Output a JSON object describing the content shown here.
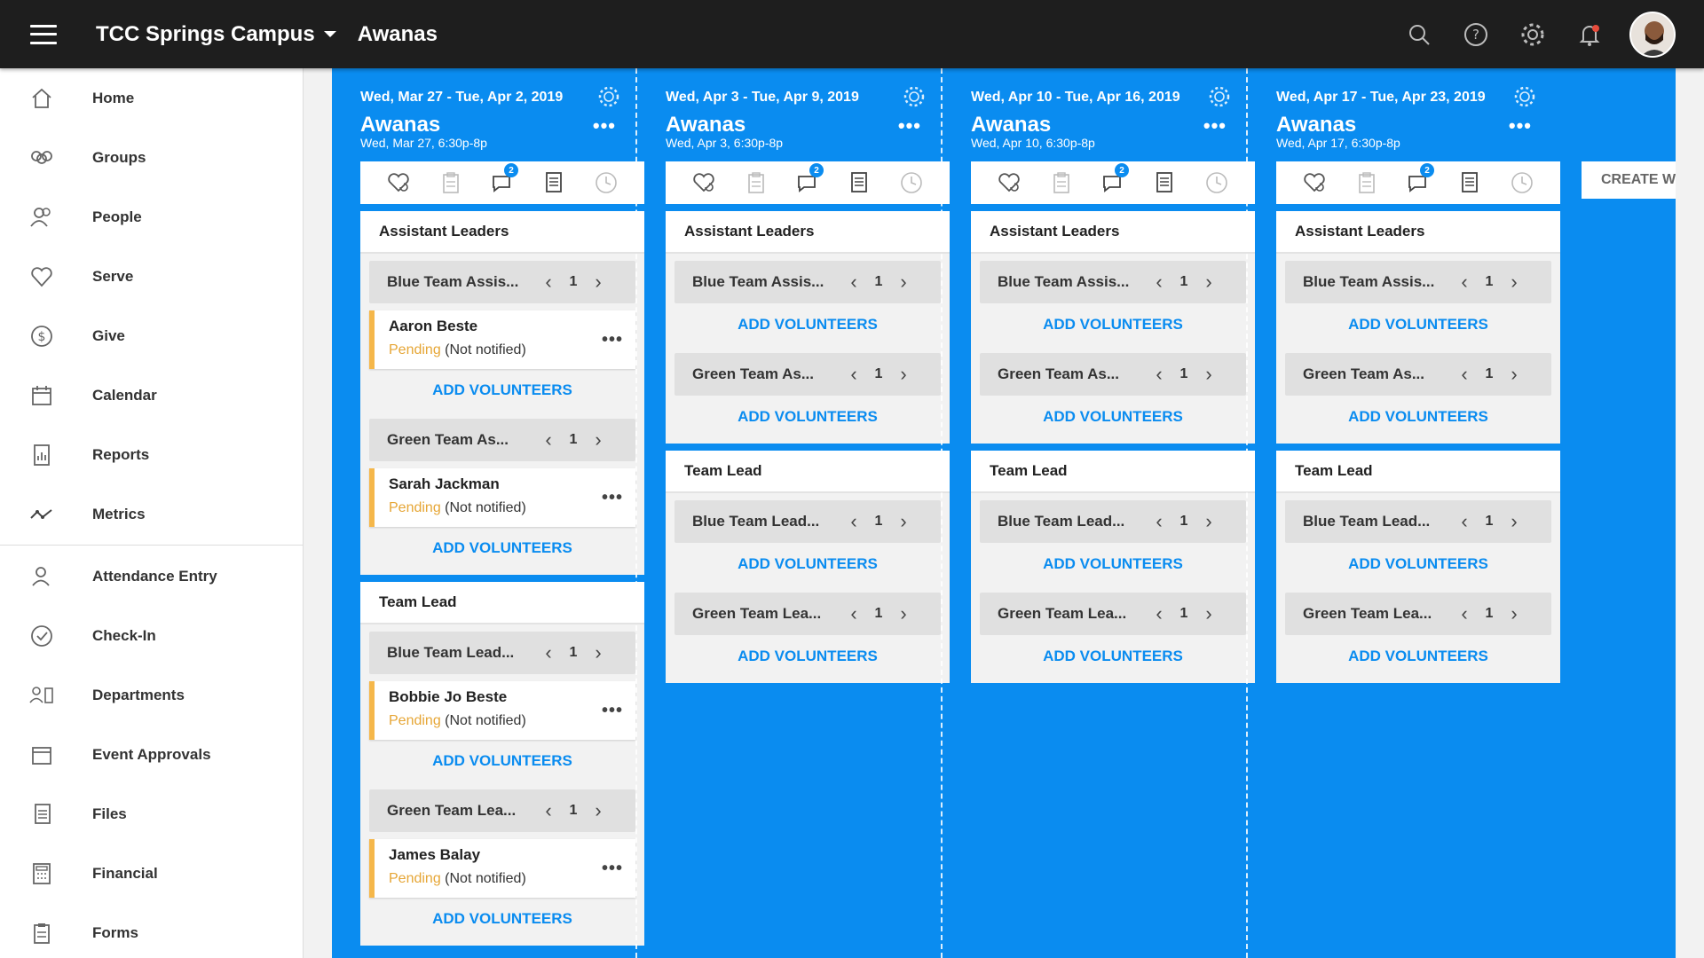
{
  "header": {
    "campus": "TCC Springs Campus",
    "page_title": "Awanas",
    "icons": [
      "search-icon",
      "help-icon",
      "gear-icon",
      "notification-bell-icon"
    ]
  },
  "sidebar": {
    "items": [
      {
        "label": "Home",
        "icon": "home-icon"
      },
      {
        "label": "Groups",
        "icon": "groups-icon"
      },
      {
        "label": "People",
        "icon": "people-icon"
      },
      {
        "label": "Serve",
        "icon": "heart-icon"
      },
      {
        "label": "Give",
        "icon": "dollar-icon"
      },
      {
        "label": "Calendar",
        "icon": "calendar-icon"
      },
      {
        "label": "Reports",
        "icon": "reports-icon"
      },
      {
        "label": "Metrics",
        "icon": "metrics-icon"
      },
      {
        "label": "Attendance Entry",
        "icon": "attendance-icon"
      },
      {
        "label": "Check-In",
        "icon": "check-in-icon"
      },
      {
        "label": "Departments",
        "icon": "departments-icon"
      },
      {
        "label": "Event Approvals",
        "icon": "event-approvals-icon"
      },
      {
        "label": "Files",
        "icon": "files-icon"
      },
      {
        "label": "Financial",
        "icon": "financial-icon"
      },
      {
        "label": "Forms",
        "icon": "forms-icon"
      }
    ]
  },
  "toolbar_badge": "2",
  "add_volunteers_label": "ADD VOLUNTEERS",
  "create_label": "CREATE W",
  "weeks": [
    {
      "range": "Wed, Mar 27 - Tue, Apr 2, 2019",
      "name": "Awanas",
      "time": "Wed, Mar 27, 6:30p-8p",
      "roles": [
        {
          "title": "Assistant Leaders",
          "teams": [
            {
              "name": "Blue Team Assis...",
              "count": "1",
              "people": [
                {
                  "name": "Aaron Beste",
                  "status": "Pending",
                  "note": "(Not notified)"
                }
              ]
            },
            {
              "name": "Green Team As...",
              "count": "1",
              "people": [
                {
                  "name": "Sarah Jackman",
                  "status": "Pending",
                  "note": "(Not notified)"
                }
              ]
            }
          ]
        },
        {
          "title": "Team Lead",
          "teams": [
            {
              "name": "Blue Team Lead...",
              "count": "1",
              "people": [
                {
                  "name": "Bobbie Jo Beste",
                  "status": "Pending",
                  "note": "(Not notified)"
                }
              ]
            },
            {
              "name": "Green Team Lea...",
              "count": "1",
              "people": [
                {
                  "name": "James Balay",
                  "status": "Pending",
                  "note": "(Not notified)"
                }
              ]
            }
          ]
        }
      ]
    },
    {
      "range": "Wed, Apr 3 - Tue, Apr 9, 2019",
      "name": "Awanas",
      "time": "Wed, Apr 3, 6:30p-8p",
      "roles": [
        {
          "title": "Assistant Leaders",
          "teams": [
            {
              "name": "Blue Team Assis...",
              "count": "1",
              "people": []
            },
            {
              "name": "Green Team As...",
              "count": "1",
              "people": []
            }
          ]
        },
        {
          "title": "Team Lead",
          "teams": [
            {
              "name": "Blue Team Lead...",
              "count": "1",
              "people": []
            },
            {
              "name": "Green Team Lea...",
              "count": "1",
              "people": []
            }
          ]
        }
      ]
    },
    {
      "range": "Wed, Apr 10 - Tue, Apr 16, 2019",
      "name": "Awanas",
      "time": "Wed, Apr 10, 6:30p-8p",
      "roles": [
        {
          "title": "Assistant Leaders",
          "teams": [
            {
              "name": "Blue Team Assis...",
              "count": "1",
              "people": []
            },
            {
              "name": "Green Team As...",
              "count": "1",
              "people": []
            }
          ]
        },
        {
          "title": "Team Lead",
          "teams": [
            {
              "name": "Blue Team Lead...",
              "count": "1",
              "people": []
            },
            {
              "name": "Green Team Lea...",
              "count": "1",
              "people": []
            }
          ]
        }
      ]
    },
    {
      "range": "Wed, Apr 17 - Tue, Apr 23, 2019",
      "name": "Awanas",
      "time": "Wed, Apr 17, 6:30p-8p",
      "roles": [
        {
          "title": "Assistant Leaders",
          "teams": [
            {
              "name": "Blue Team Assis...",
              "count": "1",
              "people": []
            },
            {
              "name": "Green Team As...",
              "count": "1",
              "people": []
            }
          ]
        },
        {
          "title": "Team Lead",
          "teams": [
            {
              "name": "Blue Team Lead...",
              "count": "1",
              "people": []
            },
            {
              "name": "Green Team Lea...",
              "count": "1",
              "people": []
            }
          ]
        }
      ]
    }
  ]
}
